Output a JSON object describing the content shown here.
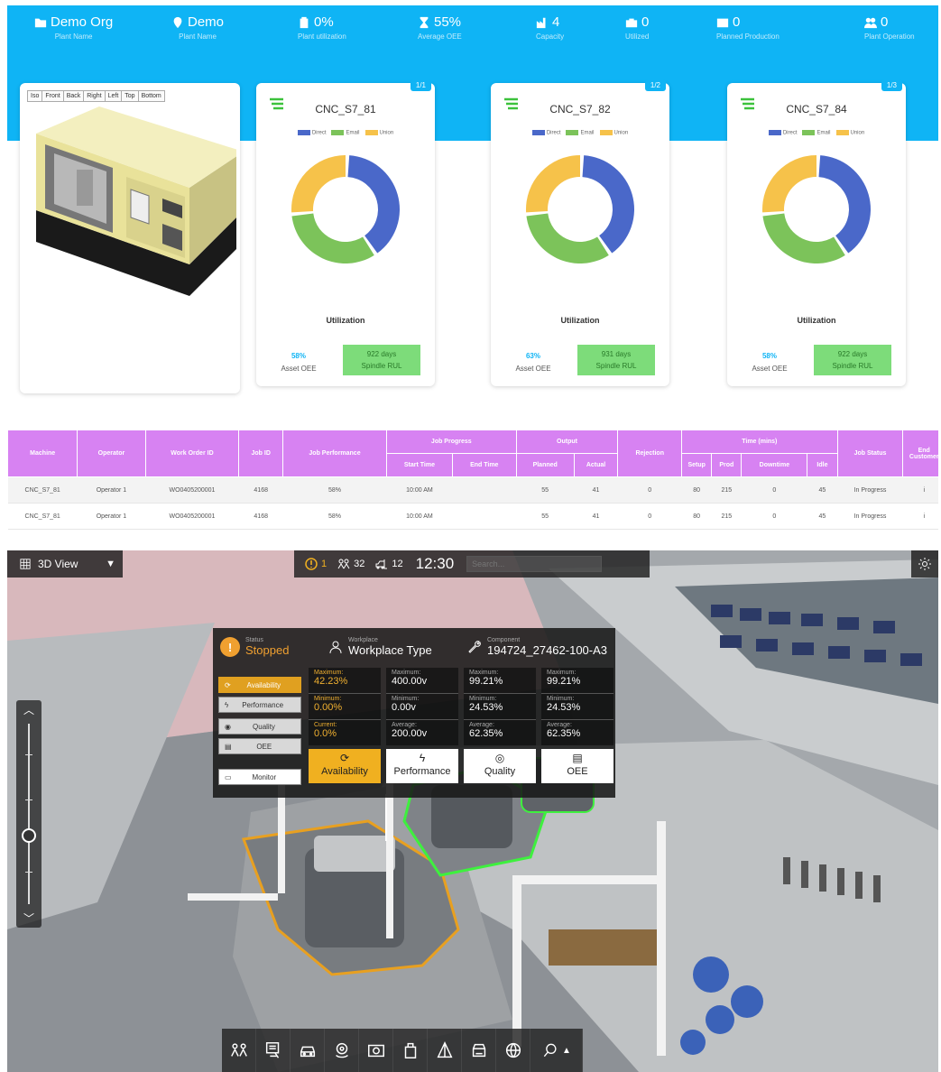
{
  "kpis": [
    {
      "value": "Demo Org",
      "label": "Plant Name",
      "icon": "folder-icon"
    },
    {
      "value": "Demo",
      "label": "Plant Name",
      "icon": "location-pin-icon"
    },
    {
      "value": "0%",
      "label": "Plant utilization",
      "icon": "battery-icon"
    },
    {
      "value": "55%",
      "label": "Average OEE",
      "icon": "hourglass-icon"
    },
    {
      "value": "4",
      "label": "Capacity",
      "icon": "factory-icon"
    },
    {
      "value": "0",
      "label": "Utilized",
      "icon": "briefcase-icon"
    },
    {
      "value": "0",
      "label": "Planned Production",
      "icon": "calendar-icon"
    },
    {
      "value": "0",
      "label": "Plant Operation",
      "icon": "users-icon"
    }
  ],
  "view_tabs": [
    "Iso",
    "Front",
    "Back",
    "Right",
    "Left",
    "Top",
    "Bottom"
  ],
  "legend": [
    "Direct",
    "Email",
    "Union"
  ],
  "series_colors": {
    "direct": "#4a68c9",
    "email": "#7cc35a",
    "union": "#f6c24a"
  },
  "machines": [
    {
      "name": "CNC_S7_81",
      "badge": "1/1",
      "oee": "58%",
      "oee_label": "Asset OEE",
      "rul_value": "922 days",
      "rul_label": "Spindle RUL",
      "util_label": "Utilization"
    },
    {
      "name": "CNC_S7_82",
      "badge": "1/2",
      "oee": "63%",
      "oee_label": "Asset OEE",
      "rul_value": "931 days",
      "rul_label": "Spindle RUL",
      "util_label": "Utilization"
    },
    {
      "name": "CNC_S7_84",
      "badge": "1/3",
      "oee": "58%",
      "oee_label": "Asset OEE",
      "rul_value": "922 days",
      "rul_label": "Spindle RUL",
      "util_label": "Utilization"
    }
  ],
  "chart_data": [
    {
      "type": "pie",
      "categories": [
        "Direct",
        "Email",
        "Union"
      ],
      "values": [
        40,
        33,
        27
      ]
    },
    {
      "type": "pie",
      "categories": [
        "Direct",
        "Email",
        "Union"
      ],
      "values": [
        40,
        33,
        27
      ]
    },
    {
      "type": "pie",
      "categories": [
        "Direct",
        "Email",
        "Union"
      ],
      "values": [
        40,
        33,
        27
      ]
    }
  ],
  "table": {
    "headers_top": [
      "Machine",
      "Operator",
      "Work Order ID",
      "Job ID",
      "Job Performance",
      "Job Progress",
      "Output",
      "Rejection",
      "Time (mins)",
      "Job Status",
      "End Customer"
    ],
    "headers_sub": [
      "Start Time",
      "End Time",
      "Planned",
      "Actual",
      "Setup",
      "Prod",
      "Downtime",
      "Idle"
    ],
    "rows": [
      [
        "CNC_S7_81",
        "Operator 1",
        "WO0405200001",
        "4168",
        "58%",
        "10:00 AM",
        "",
        "55",
        "41",
        "0",
        "80",
        "215",
        "0",
        "45",
        "In Progress",
        "i"
      ],
      [
        "CNC_S7_81",
        "Operator 1",
        "WO0405200001",
        "4168",
        "58%",
        "10:00 AM",
        "",
        "55",
        "41",
        "0",
        "80",
        "215",
        "0",
        "45",
        "In Progress",
        "i"
      ]
    ]
  },
  "viewer": {
    "view_label": "3D View",
    "alerts": "1",
    "people": "32",
    "vehicles": "12",
    "time": "12:30",
    "search_placeholder": "Search...",
    "status_caption": "Status",
    "status_value": "Stopped",
    "workplace_caption": "Workplace",
    "workplace_value": "Workplace Type",
    "component_caption": "Component",
    "component_value": "194724_27462-100-A3",
    "side_buttons": [
      "Availability",
      "Performance",
      "Quality",
      "OEE"
    ],
    "monitor_label": "Monitor",
    "metric_columns": [
      {
        "r1l": "Maximum:",
        "r1v": "42.23%",
        "r2l": "Minimum:",
        "r2v": "0.00%",
        "r3l": "Current:",
        "r3v": "0.0%",
        "button": "Availability"
      },
      {
        "r1l": "Maximum:",
        "r1v": "400.00v",
        "r2l": "Minimum:",
        "r2v": "0.00v",
        "r3l": "Average:",
        "r3v": "200.00v",
        "button": "Performance"
      },
      {
        "r1l": "Maximum:",
        "r1v": "99.21%",
        "r2l": "Minimum:",
        "r2v": "24.53%",
        "r3l": "Average:",
        "r3v": "62.35%",
        "button": "Quality"
      },
      {
        "r1l": "Maximum:",
        "r1v": "99.21%",
        "r2l": "Minimum:",
        "r2v": "24.53%",
        "r3l": "Average:",
        "r3v": "62.35%",
        "button": "OEE"
      }
    ],
    "slider_level": 0.38,
    "toolbar_icons": [
      "people-icon",
      "monitor-icon",
      "car-icon",
      "camera-rotate-icon",
      "camera-icon",
      "bag-icon",
      "cone-icon",
      "vehicle-front-icon",
      "globe-icon",
      "search-icon"
    ]
  }
}
